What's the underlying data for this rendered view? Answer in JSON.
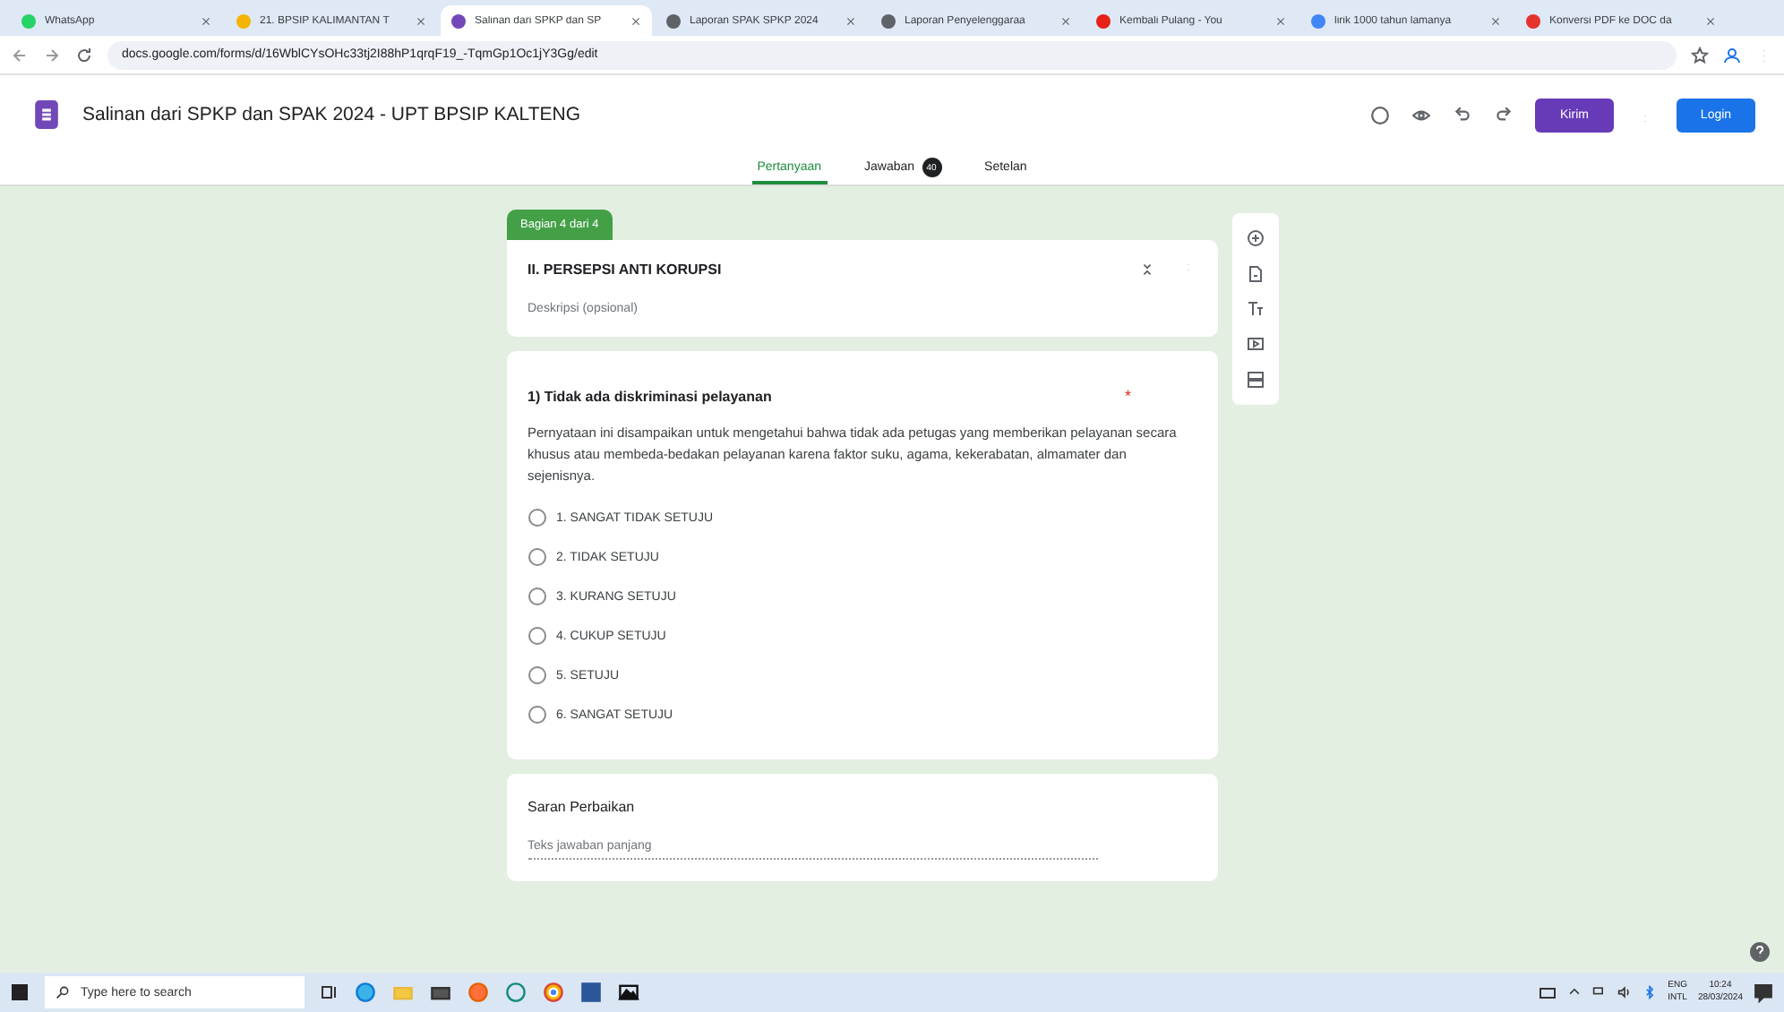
{
  "browser_tabs": [
    {
      "label": "WhatsApp",
      "selected": false,
      "color": "#25d366"
    },
    {
      "label": "21. BPSIP KALIMANTAN T",
      "selected": false,
      "color": "#f4b400"
    },
    {
      "label": "Salinan dari SPKP dan SP",
      "selected": true,
      "color": "#7248b9"
    },
    {
      "label": "Laporan SPAK SPKP 2024",
      "selected": false,
      "color": "#5f6368"
    },
    {
      "label": "Laporan Penyelenggaraa",
      "selected": false,
      "color": "#5f6368"
    },
    {
      "label": "Kembali Pulang - You",
      "selected": false,
      "color": "#e62117"
    },
    {
      "label": "lirik 1000 tahun lamanya",
      "selected": false,
      "color": "#4285f4"
    },
    {
      "label": "Konversi PDF ke DOC da",
      "selected": false,
      "color": "#e5322d"
    }
  ],
  "url": "docs.google.com/forms/d/16WblCYsOHc33tj2I88hP1qrqF19_-TqmGp1Oc1jY3Gg/edit",
  "form_title": "Salinan dari SPKP dan SPAK  2024 - UPT BPSIP KALTENG",
  "send_button": "Kirim",
  "login_button": "Login",
  "form_tabs": [
    {
      "label": "Pertanyaan",
      "selected": true
    },
    {
      "label": "Jawaban",
      "selected": false,
      "count": "40"
    },
    {
      "label": "Setelan",
      "selected": false
    }
  ],
  "section_tag": "Bagian 4 dari 4",
  "section": {
    "title": "II. PERSEPSI ANTI KORUPSI",
    "description_placeholder": "Deskripsi (opsional)"
  },
  "question": {
    "title": "1) Tidak ada diskriminasi pelayanan",
    "required_mark": "*",
    "description": "Pernyataan ini disampaikan untuk mengetahui bahwa tidak ada petugas yang memberikan pelayanan secara khusus atau membeda-bedakan pelayanan karena faktor suku, agama, kekerabatan, almamater dan sejenisnya.",
    "options": [
      {
        "label": "1. SANGAT TIDAK SETUJU",
        "selected": false
      },
      {
        "label": "2. TIDAK SETUJU",
        "selected": false
      },
      {
        "label": "3. KURANG SETUJU",
        "selected": false
      },
      {
        "label": "4. CUKUP SETUJU",
        "selected": false
      },
      {
        "label": "5. SETUJU",
        "selected": false
      },
      {
        "label": "6. SANGAT SETUJU",
        "selected": false
      }
    ]
  },
  "long_question": {
    "title": "Saran Perbaikan",
    "placeholder": "Teks jawaban panjang"
  },
  "taskbar": {
    "search_placeholder": "Type here to search",
    "language": "ENG",
    "layout": "INTL",
    "time": "10:24",
    "date": "28/03/2024"
  }
}
